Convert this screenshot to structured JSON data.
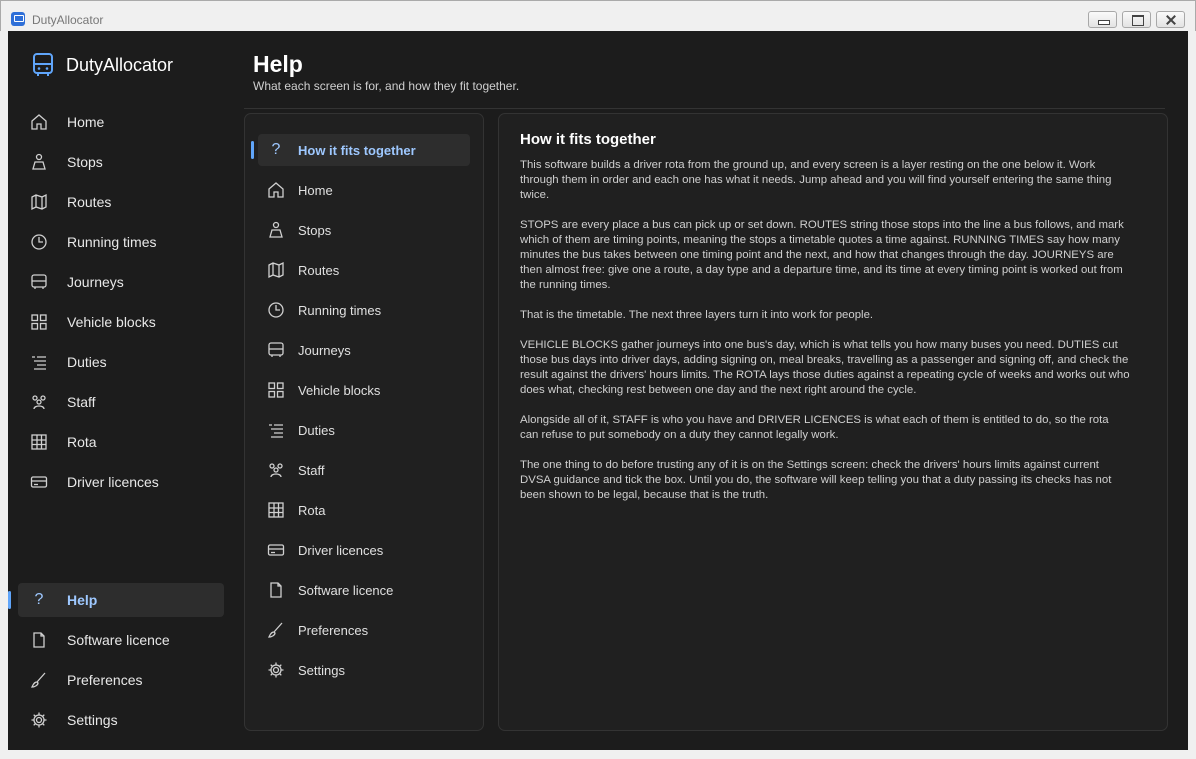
{
  "window": {
    "title": "DutyAllocator"
  },
  "sidebar": {
    "brand": "DutyAllocator",
    "items": [
      {
        "label": "Home",
        "icon": "home-icon"
      },
      {
        "label": "Stops",
        "icon": "person-icon"
      },
      {
        "label": "Routes",
        "icon": "map-icon"
      },
      {
        "label": "Running times",
        "icon": "clock-icon"
      },
      {
        "label": "Journeys",
        "icon": "bus-icon"
      },
      {
        "label": "Vehicle blocks",
        "icon": "grid-icon"
      },
      {
        "label": "Duties",
        "icon": "list-icon"
      },
      {
        "label": "Staff",
        "icon": "people-icon"
      },
      {
        "label": "Rota",
        "icon": "table-icon"
      },
      {
        "label": "Driver licences",
        "icon": "card-icon"
      }
    ],
    "footer_items": [
      {
        "label": "Help",
        "icon": "question-icon",
        "active": true
      },
      {
        "label": "Software licence",
        "icon": "document-icon"
      },
      {
        "label": "Preferences",
        "icon": "brush-icon"
      },
      {
        "label": "Settings",
        "icon": "gear-icon"
      }
    ]
  },
  "header": {
    "title": "Help",
    "subtitle": "What each screen is for, and how they fit together."
  },
  "help_toc": [
    {
      "label": "How it fits together",
      "icon": "question-icon",
      "active": true
    },
    {
      "label": "Home",
      "icon": "home-icon"
    },
    {
      "label": "Stops",
      "icon": "person-icon"
    },
    {
      "label": "Routes",
      "icon": "map-icon"
    },
    {
      "label": "Running times",
      "icon": "clock-icon"
    },
    {
      "label": "Journeys",
      "icon": "bus-icon"
    },
    {
      "label": "Vehicle blocks",
      "icon": "grid-icon"
    },
    {
      "label": "Duties",
      "icon": "list-icon"
    },
    {
      "label": "Staff",
      "icon": "people-icon"
    },
    {
      "label": "Rota",
      "icon": "table-icon"
    },
    {
      "label": "Driver licences",
      "icon": "card-icon"
    },
    {
      "label": "Software licence",
      "icon": "document-icon"
    },
    {
      "label": "Preferences",
      "icon": "brush-icon"
    },
    {
      "label": "Settings",
      "icon": "gear-icon"
    }
  ],
  "help_content": {
    "title": "How it fits together",
    "paragraphs": [
      "This software builds a driver rota from the ground up, and every screen is a layer resting on the one below it. Work through them in order and each one has what it needs. Jump ahead and you will find yourself entering the same thing twice.",
      "STOPS are every place a bus can pick up or set down. ROUTES string those stops into the line a bus follows, and mark which of them are timing points, meaning the stops a timetable quotes a time against. RUNNING TIMES say how many minutes the bus takes between one timing point and the next, and how that changes through the day. JOURNEYS are then almost free: give one a route, a day type and a departure time, and its time at every timing point is worked out from the running times.",
      "That is the timetable. The next three layers turn it into work for people.",
      "VEHICLE BLOCKS gather journeys into one bus's day, which is what tells you how many buses you need. DUTIES cut those bus days into driver days, adding signing on, meal breaks, travelling as a passenger and signing off, and check the result against the drivers' hours limits. The ROTA lays those duties against a repeating cycle of weeks and works out who does what, checking rest between one day and the next right around the cycle.",
      "Alongside all of it, STAFF is who you have and DRIVER LICENCES is what each of them is entitled to do, so the rota can refuse to put somebody on a duty they cannot legally work.",
      "The one thing to do before trusting any of it is on the Settings screen: check the drivers' hours limits against current DVSA guidance and tick the box. Until you do, the software will keep telling you that a duty passing its checks has not been shown to be legal, because that is the truth."
    ]
  },
  "colors": {
    "background": "#1c1c1c",
    "panel": "#202020",
    "accent": "#60a5fa",
    "accent_text": "#9ec8ff"
  }
}
